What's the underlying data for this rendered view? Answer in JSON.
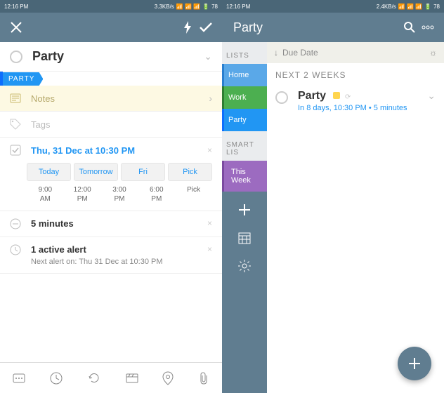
{
  "status": {
    "time": "12:16 PM",
    "net_left": "3.3KB/s",
    "net_right": "2.4KB/s",
    "battery": "78"
  },
  "left": {
    "task_title": "Party",
    "party_tab": "PARTY",
    "notes_label": "Notes",
    "tags_label": "Tags",
    "datetime": "Thu, 31 Dec at 10:30 PM",
    "quick": {
      "today": "Today",
      "tomorrow": "Tomorrow",
      "fri": "Fri",
      "pick": "Pick"
    },
    "times": {
      "t1": "9:00\nAM",
      "t2": "12:00\nPM",
      "t3": "3:00\nPM",
      "t4": "6:00\nPM",
      "t5": "Pick"
    },
    "duration": "5 minutes",
    "alert_title": "1 active alert",
    "alert_sub": "Next alert on: Thu 31 Dec at 10:30 PM"
  },
  "right": {
    "header_title": "Party",
    "due_label": "Due Date",
    "section": "NEXT 2 WEEKS",
    "lists_label": "LISTS",
    "smart_label": "SMART LIS",
    "side": {
      "home": "Home",
      "work": "Work",
      "party": "Party",
      "week": "This Week"
    },
    "task": {
      "name": "Party",
      "sub": "In 8 days, 10:30 PM • 5 minutes"
    }
  }
}
